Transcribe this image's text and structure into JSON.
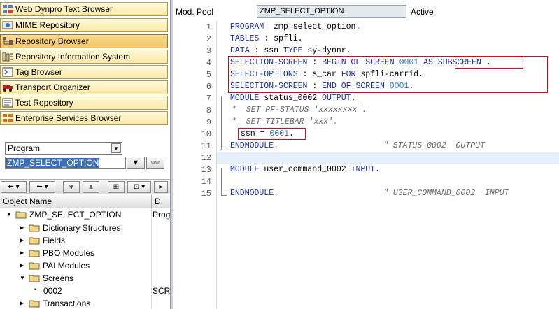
{
  "nav": {
    "items": [
      {
        "label": "Web Dynpro Text Browser",
        "icon": "web-dynpro-icon"
      },
      {
        "label": "MIME Repository",
        "icon": "mime-icon"
      },
      {
        "label": "Repository Browser",
        "icon": "repository-browser-icon",
        "active": true
      },
      {
        "label": "Repository Information System",
        "icon": "repository-info-icon"
      },
      {
        "label": "Tag Browser",
        "icon": "tag-icon"
      },
      {
        "label": "Transport Organizer",
        "icon": "transport-icon"
      },
      {
        "label": "Test Repository",
        "icon": "test-icon"
      },
      {
        "label": "Enterprise Services Browser",
        "icon": "enterprise-services-icon"
      }
    ]
  },
  "selector": {
    "object_type": "Program",
    "object_name": "ZMP_SELECT_OPTION"
  },
  "tree": {
    "col1": "Object Name",
    "col2": "D.",
    "rows": [
      {
        "label": "ZMP_SELECT_OPTION",
        "desc": "Prog",
        "expanded": true
      },
      {
        "label": "Dictionary Structures"
      },
      {
        "label": "Fields"
      },
      {
        "label": "PBO Modules"
      },
      {
        "label": "PAI Modules"
      },
      {
        "label": "Screens",
        "expanded": true
      },
      {
        "label": "0002",
        "desc": "SCR"
      },
      {
        "label": "Transactions"
      }
    ]
  },
  "editor": {
    "type_label": "Mod. Pool",
    "program_name": "ZMP_SELECT_OPTION",
    "status": "Active",
    "line_numbers": [
      "1",
      "2",
      "3",
      "4",
      "5",
      "6",
      "7",
      "8",
      "9",
      "10",
      "11",
      "12",
      "13",
      "14",
      "15"
    ]
  },
  "code": {
    "l1a": "PROGRAM",
    "l1b": "  zmp_select_option.",
    "l2a": "TABLES",
    "l2b": " : spfli.",
    "l3a": "DATA",
    "l3b": " : ssn ",
    "l3c": "TYPE",
    "l3d": " sy-dynnr.",
    "l4a": "SELECTION-SCREEN",
    "l4b": " : ",
    "l4c": "BEGIN OF SCREEN",
    "l4d": " 0001 ",
    "l4e": "AS SUBSCREEN",
    "l4f": " .",
    "l5a": "SELECT-OPTIONS",
    "l5b": " : s_car ",
    "l5c": "FOR",
    "l5d": " spfli-carrid.",
    "l6a": "SELECTION-SCREEN",
    "l6b": " : ",
    "l6c": "END OF SCREEN",
    "l6d": " 0001",
    "l6e": ".",
    "l7a": "MODULE",
    "l7b": " status_0002 ",
    "l7c": "OUTPUT",
    "l7d": ".",
    "l8": "*  SET PF-STATUS 'xxxxxxxx'.",
    "l9": "*  SET TITLEBAR 'xxx'.",
    "l10a": "ssn = ",
    "l10b": "0001",
    "l10c": ".",
    "l11a": "ENDMODULE",
    "l11b": ".",
    "l11c": "\" STATUS_0002  OUTPUT",
    "l13a": "MODULE",
    "l13b": " user_command_0002 ",
    "l13c": "INPUT",
    "l13d": ".",
    "l15a": "ENDMODULE",
    "l15b": ".",
    "l15c": "\" USER_COMMAND_0002  INPUT"
  },
  "colors": {
    "keyword": "#1b2fb8",
    "comment": "#6b6b6b",
    "number": "#3078c8",
    "highlight_box": "#c8101a",
    "nav_button": "#fde9a4"
  }
}
